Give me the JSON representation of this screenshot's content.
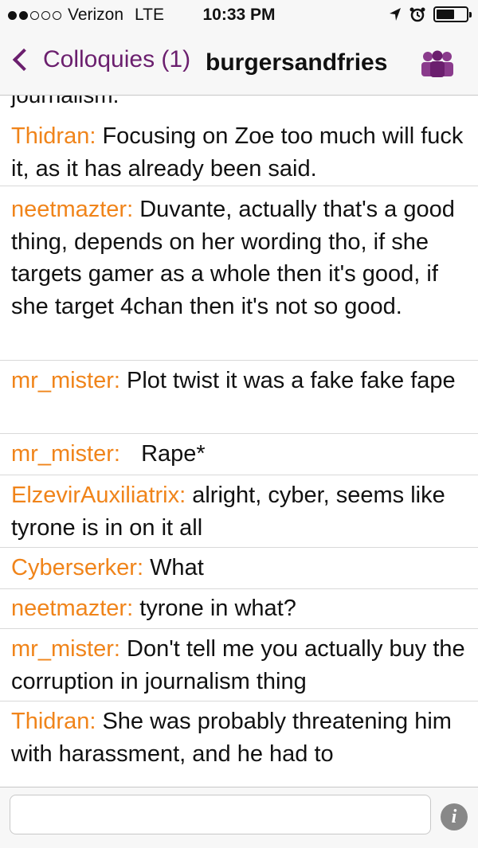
{
  "status_bar": {
    "carrier": "Verizon",
    "network": "LTE",
    "time": "10:33 PM",
    "signal_bars": 2,
    "battery_level": 0.55
  },
  "nav": {
    "back_label": "Colloquies (1)",
    "title": "burgersandfries",
    "people_icon": "group-icon",
    "accent_color": "#6b1f6e"
  },
  "messages": {
    "cut_off_text": "journalism.",
    "items": [
      {
        "user": "Thidran",
        "text": "Focusing on Zoe too much will fuck it, as it has already been said."
      },
      {
        "user": "neetmazter",
        "text": "Duvante, actually that's a good thing, depends on her wording tho, if she targets gamer as a whole then it's good, if she target 4chan then it's not so good."
      },
      {
        "user": "mr_mister",
        "text": "Plot twist it was a fake fake fape"
      },
      {
        "user": "mr_mister",
        "text": "Rape*"
      },
      {
        "user": "ElzevirAuxiliatrix",
        "text": "alright, cyber, seems like tyrone is in on it all"
      },
      {
        "user": "Cyberserker",
        "text": "What"
      },
      {
        "user": "neetmazter",
        "text": "tyrone in what?"
      },
      {
        "user": "mr_mister",
        "text": "Don't tell me you actually buy the corruption in journalism thing"
      },
      {
        "user": "Thidran",
        "text": "She was probably threatening him with harassment, and he had to"
      }
    ],
    "username_color": "#f0841a"
  },
  "composer": {
    "input_value": "",
    "info_icon": "info-icon"
  }
}
